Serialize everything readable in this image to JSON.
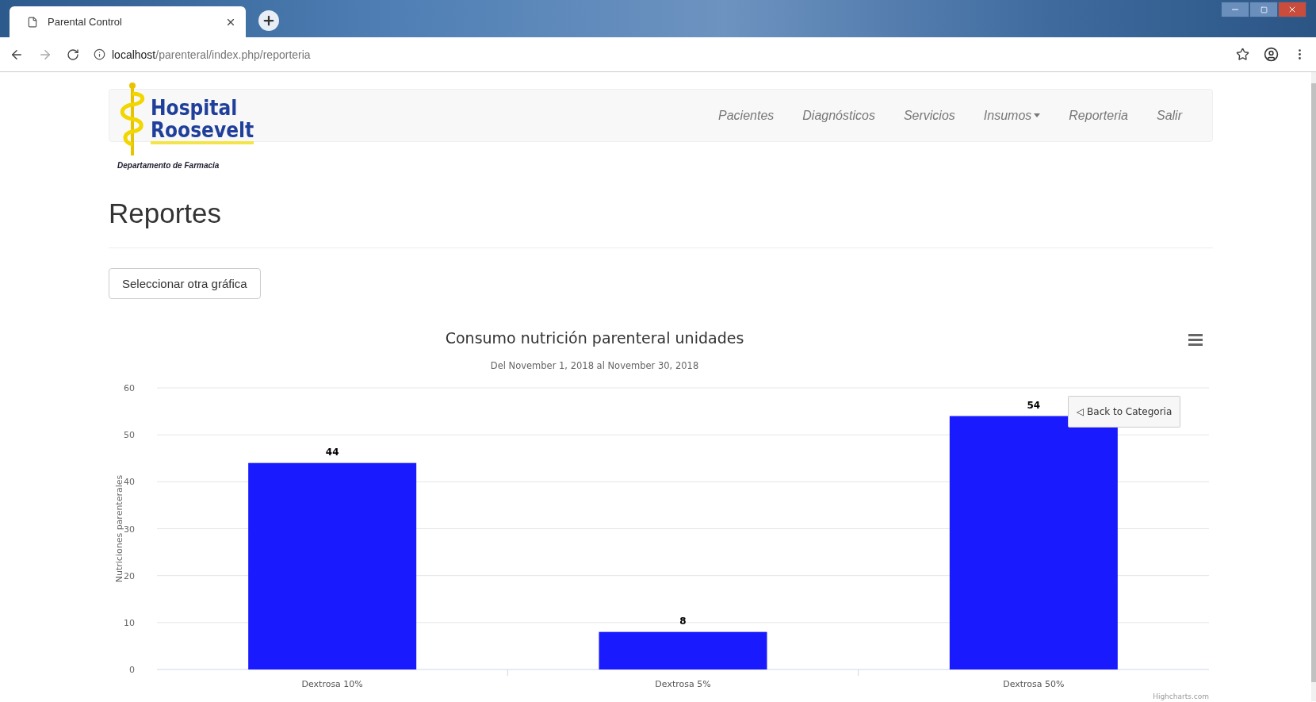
{
  "browser": {
    "tab_title": "Parental Control",
    "url_host": "localhost",
    "url_path": "/parenteral/index.php/reporteria"
  },
  "navbar": {
    "logo_line1": "Hospital",
    "logo_line2": "Roosevelt",
    "logo_subtitle": "Departamento de Farmacia",
    "items": [
      {
        "label": "Pacientes",
        "kind": "link"
      },
      {
        "label": "Diagnósticos",
        "kind": "link"
      },
      {
        "label": "Servicios",
        "kind": "link"
      },
      {
        "label": "Insumos",
        "kind": "dropdown"
      },
      {
        "label": "Reporteria",
        "kind": "link"
      },
      {
        "label": "Salir",
        "kind": "link"
      }
    ]
  },
  "page_title": "Reportes",
  "select_button": "Seleccionar otra gráfica",
  "chart": {
    "subtitle": "Del November 1, 2018 al November 30, 2018",
    "back_button": "◁ Back to Categoria",
    "credit": "Highcharts.com",
    "chart_data": {
      "type": "bar",
      "title": "Consumo nutrición parenteral unidades",
      "ylabel": "Nutriciones parenterales",
      "categories": [
        "Dextrosa 10%",
        "Dextrosa 5%",
        "Dextrosa 50%"
      ],
      "series": [
        {
          "color": "#1a1aff",
          "values": [
            44,
            8,
            54
          ]
        }
      ],
      "grid": true,
      "ylim": [
        0,
        60
      ],
      "yticks": [
        0,
        10,
        20,
        30,
        40,
        50,
        60
      ],
      "data_labels": true
    }
  }
}
